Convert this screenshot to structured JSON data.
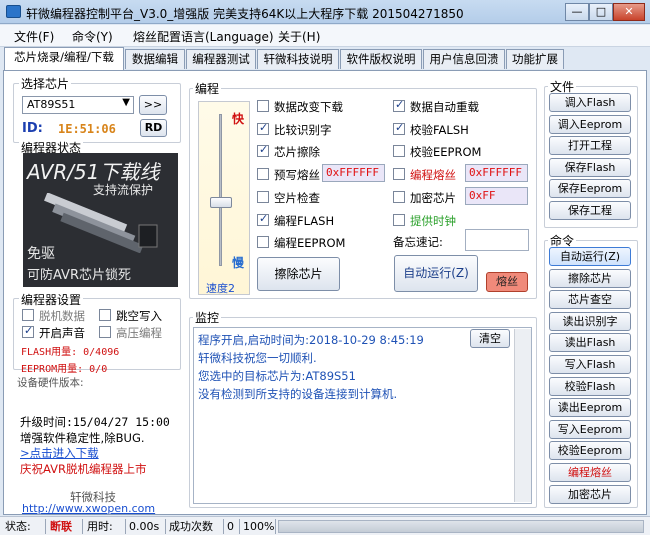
{
  "window": {
    "title": "轩微编程器控制平台_V3.0_增强版 完美支持64K以上大程序下载 201504271850",
    "minimize": "—",
    "maximize": "□",
    "close": "✕"
  },
  "menu": [
    "文件(F)",
    "命令(Y)",
    "熔丝配置语言(Language)",
    "关于(H)"
  ],
  "tabs": [
    "芯片烧录/编程/下载",
    "数据编辑",
    "编程器测试",
    "轩微科技说明",
    "软件版权说明",
    "用户信息回溃",
    "功能扩展"
  ],
  "chip": {
    "group_label": "选择芯片",
    "selected": "AT89S51",
    "more_button": ">>",
    "id_label": "ID:",
    "id_value": "1E:51:06",
    "rd_button": "RD"
  },
  "status_group": {
    "label": "编程器状态",
    "banner_title": "AVR/51下载线",
    "banner_sub": "支持流保护",
    "banner_bottom1": "免驱",
    "banner_bottom2": "可防AVR芯片锁死"
  },
  "settings": {
    "label": "编程器设置",
    "options": [
      {
        "label": "脱机数据",
        "checked": false,
        "grey": true
      },
      {
        "label": "跳空写入",
        "checked": false,
        "grey": false
      },
      {
        "label": "开启声音",
        "checked": true,
        "grey": false
      },
      {
        "label": "高压编程",
        "checked": false,
        "grey": true
      }
    ],
    "flash_usage": "FLASH用量: 0/4096",
    "eeprom_usage": "EEPROM用量: 0/0",
    "hw_version": "设备硬件版本:"
  },
  "notice": {
    "upgrade_time": "升级时间:15/04/27 15:00",
    "upgrade_desc": "增强软件稳定性,除BUG.",
    "download_link": ">点击进入下载",
    "promo": "庆祝AVR脱机编程器上市",
    "company": "轩微科技",
    "url": "http://www.xwopen.com"
  },
  "program": {
    "label": "编程",
    "speed_fast": "快",
    "speed_slow": "慢",
    "speed_label": "速度2",
    "options_left": [
      {
        "label": "数据改变下载",
        "checked": false
      },
      {
        "label": "比较识别字",
        "checked": true
      },
      {
        "label": "芯片擦除",
        "checked": true
      },
      {
        "label": "预写熔丝",
        "checked": false
      },
      {
        "label": "空片检查",
        "checked": false
      },
      {
        "label": "编程FLASH",
        "checked": true
      },
      {
        "label": "编程EEPROM",
        "checked": false
      }
    ],
    "options_right": [
      {
        "label": "数据自动重载",
        "checked": true,
        "color": "#000000"
      },
      {
        "label": "校验FALSH",
        "checked": true,
        "color": "#000000"
      },
      {
        "label": "校验EEPROM",
        "checked": false,
        "color": "#000000"
      },
      {
        "label": "编程熔丝",
        "checked": false,
        "color": "#d01010"
      },
      {
        "label": "加密芯片",
        "checked": false,
        "color": "#000000"
      },
      {
        "label": "提供时钟",
        "checked": false,
        "color": "#2aa02a"
      }
    ],
    "prewrite_fuse_value": "0xFFFFFF",
    "program_fuse_value": "0xFFFFFF",
    "encrypt_value": "0xFF",
    "memo_label": "备忘速记:",
    "memo_value": "",
    "erase_button": "擦除芯片",
    "auto_button": "自动运行(Z)",
    "fuse_button": "熔丝"
  },
  "monitor": {
    "label": "监控",
    "clear_button": "清空",
    "lines": [
      "程序开启,启动时间为:2018-10-29 8:45:19",
      "轩微科技祝您一切顺利.",
      "您选中的目标芯片为:AT89S51",
      "没有检测到所支持的设备连接到计算机."
    ]
  },
  "file_group": {
    "label": "文件",
    "buttons": [
      "调入Flash",
      "调入Eeprom",
      "打开工程",
      "保存Flash",
      "保存Eeprom",
      "保存工程"
    ]
  },
  "cmd_group": {
    "label": "命令",
    "buttons": [
      {
        "label": "自动运行(Z)",
        "color": "#000000"
      },
      {
        "label": "擦除芯片",
        "color": "#000000"
      },
      {
        "label": "芯片查空",
        "color": "#000000"
      },
      {
        "label": "读出识别字",
        "color": "#000000"
      },
      {
        "label": "读出Flash",
        "color": "#000000"
      },
      {
        "label": "写入Flash",
        "color": "#000000"
      },
      {
        "label": "校验Flash",
        "color": "#000000"
      },
      {
        "label": "读出Eeprom",
        "color": "#000000"
      },
      {
        "label": "写入Eeprom",
        "color": "#000000"
      },
      {
        "label": "校验Eeprom",
        "color": "#000000"
      },
      {
        "label": "编程熔丝",
        "color": "#d01010"
      },
      {
        "label": "加密芯片",
        "color": "#000000"
      }
    ]
  },
  "statusbar": {
    "status_label": "状态:",
    "status_value": "断联",
    "time_label": "用时:",
    "time_value": "0.00s",
    "success_label": "成功次数",
    "success_value": "0",
    "progress_text": "100%",
    "progress_fraction": 1.0
  }
}
